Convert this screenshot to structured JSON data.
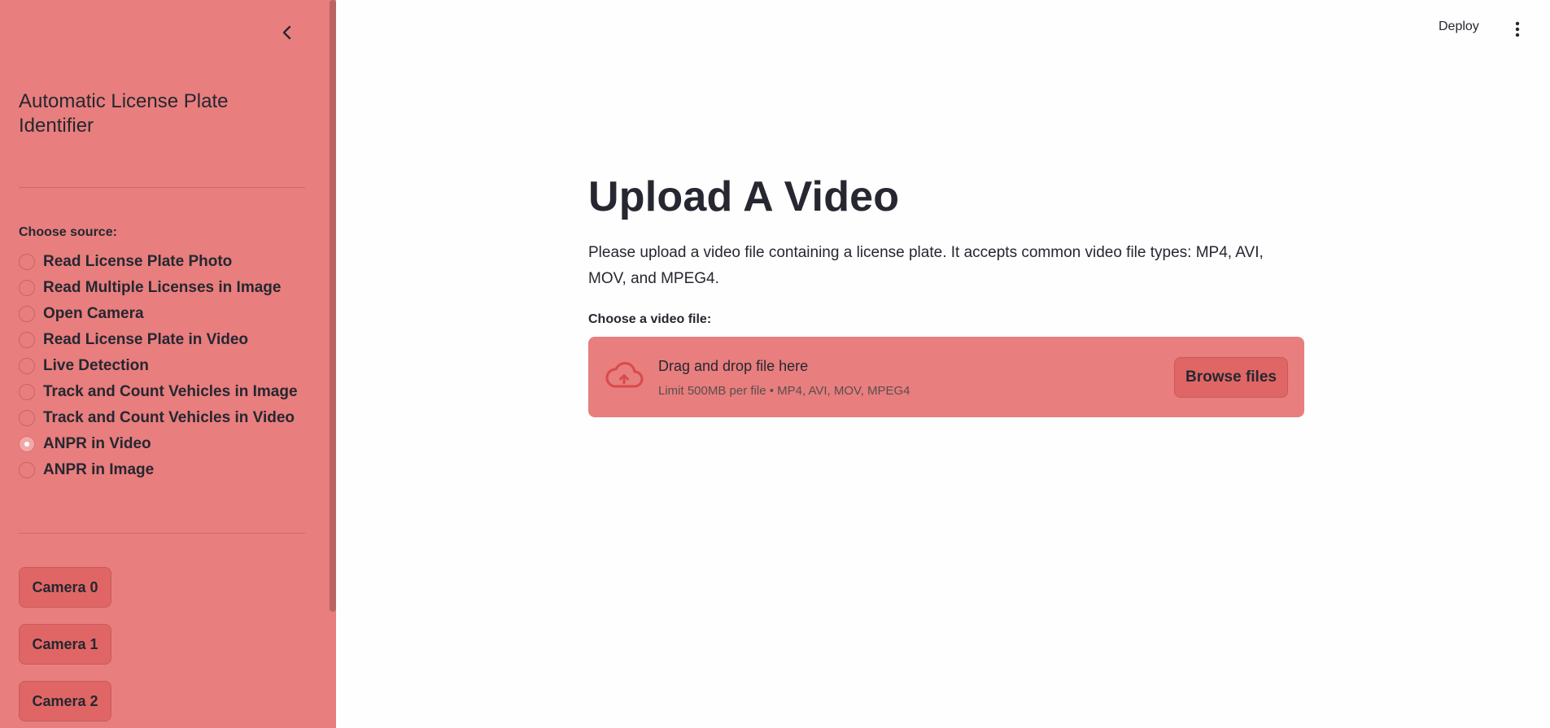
{
  "sidebar": {
    "title": "Automatic License Plate Identifier",
    "radio_label": "Choose source:",
    "options": [
      {
        "label": "Read License Plate Photo",
        "checked": false
      },
      {
        "label": "Read Multiple Licenses in Image",
        "checked": false
      },
      {
        "label": "Open Camera",
        "checked": false
      },
      {
        "label": "Read License Plate in Video",
        "checked": false
      },
      {
        "label": "Live Detection",
        "checked": false
      },
      {
        "label": "Track and Count Vehicles in Image",
        "checked": false
      },
      {
        "label": "Track and Count Vehicles in Video",
        "checked": false
      },
      {
        "label": "ANPR in Video",
        "checked": true
      },
      {
        "label": "ANPR in Image",
        "checked": false
      }
    ],
    "camera_buttons": [
      "Camera 0",
      "Camera 1",
      "Camera 2"
    ]
  },
  "header": {
    "deploy_label": "Deploy"
  },
  "main": {
    "title": "Upload A Video",
    "description": "Please upload a video file containing a license plate. It accepts common video file types: MP4, AVI, MOV, and MPEG4.",
    "uploader_label": "Choose a video file:",
    "drop_text": "Drag and drop file here",
    "drop_limit": "Limit 500MB per file • MP4, AVI, MOV, MPEG4",
    "browse_label": "Browse files"
  },
  "colors": {
    "sidebar_bg": "#e87e7e",
    "button_bg": "#e06666",
    "main_bg": "#fefefe",
    "text": "#262730",
    "accent_icon": "#d94a4a"
  },
  "icons": {
    "collapse": "chevron-left-icon",
    "menu": "kebab-menu-icon",
    "upload": "cloud-upload-icon"
  }
}
